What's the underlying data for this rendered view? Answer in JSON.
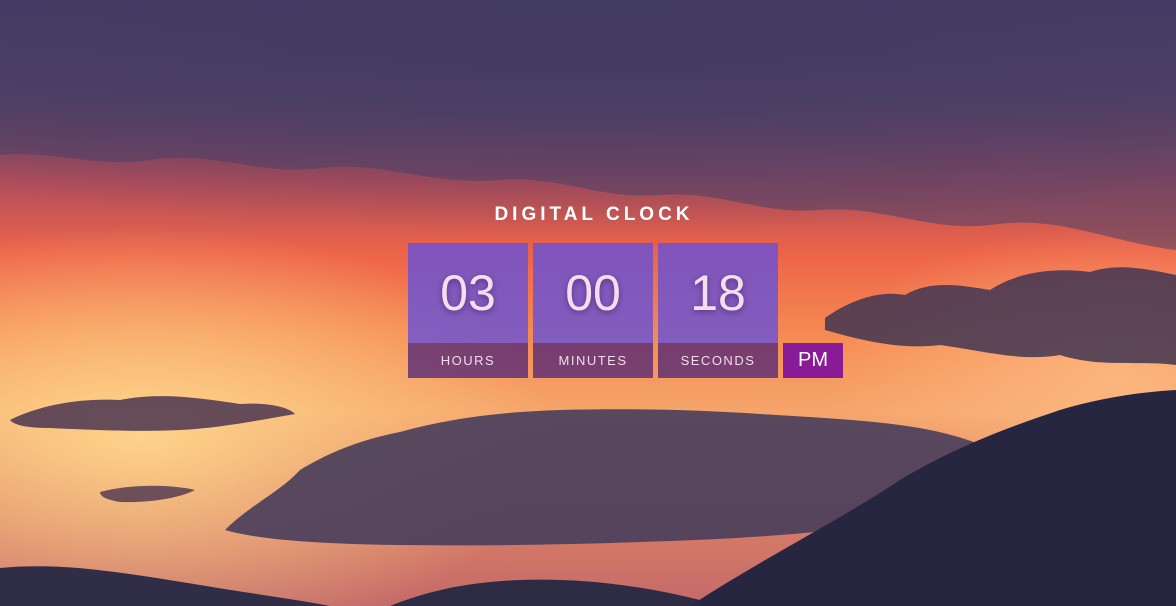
{
  "clock": {
    "title": "DIGITAL CLOCK",
    "hours": "03",
    "minutes": "00",
    "seconds": "18",
    "hours_label": "HOURS",
    "minutes_label": "MINUTES",
    "seconds_label": "SECONDS",
    "period": "PM"
  },
  "colors": {
    "digit_box": "#6952d6",
    "label_bar": "#461e78",
    "period_badge": "#8a1b96",
    "sky_top": "#463f66",
    "sky_glow": "#f0604a",
    "horizon": "#f8b873",
    "mountains": "#2a2942"
  }
}
